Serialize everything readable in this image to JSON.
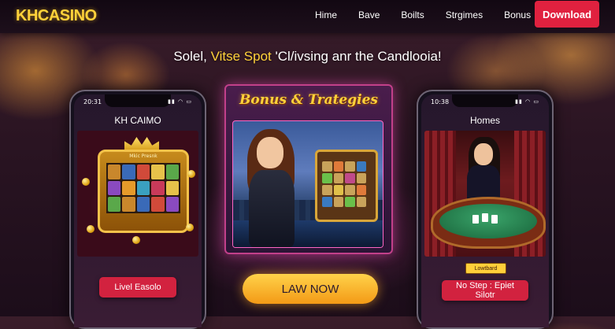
{
  "nav": {
    "logo": "KHCASINO",
    "links": [
      "Hime",
      "Bave",
      "Boilts",
      "Strgimes",
      "Bonus"
    ],
    "download_label": "Download"
  },
  "headline": {
    "part1": "Solel, ",
    "accent": "Vitse Spot",
    "part2": " 'Cl/ivsing anr the Candlooia!"
  },
  "left_phone": {
    "time": "20:31",
    "title": "KH CAIMO",
    "art_label": "Mkic Presnk",
    "button_label": "Livel Easolo"
  },
  "center_card": {
    "title": "Bonus & Trategies",
    "button_label": "LAW NOW"
  },
  "right_phone": {
    "time": "10:38",
    "title": "Homes",
    "tag_label": "Lowtbard",
    "button_label": "No Step : Epiet Silotr"
  },
  "colors": {
    "accent_gold": "#ffd23a",
    "download_red": "#e0213f",
    "button_red": "#d2223f",
    "cta_orange": "#f5a623"
  },
  "icons": [
    "signal-icon",
    "wifi-icon",
    "battery-icon"
  ]
}
